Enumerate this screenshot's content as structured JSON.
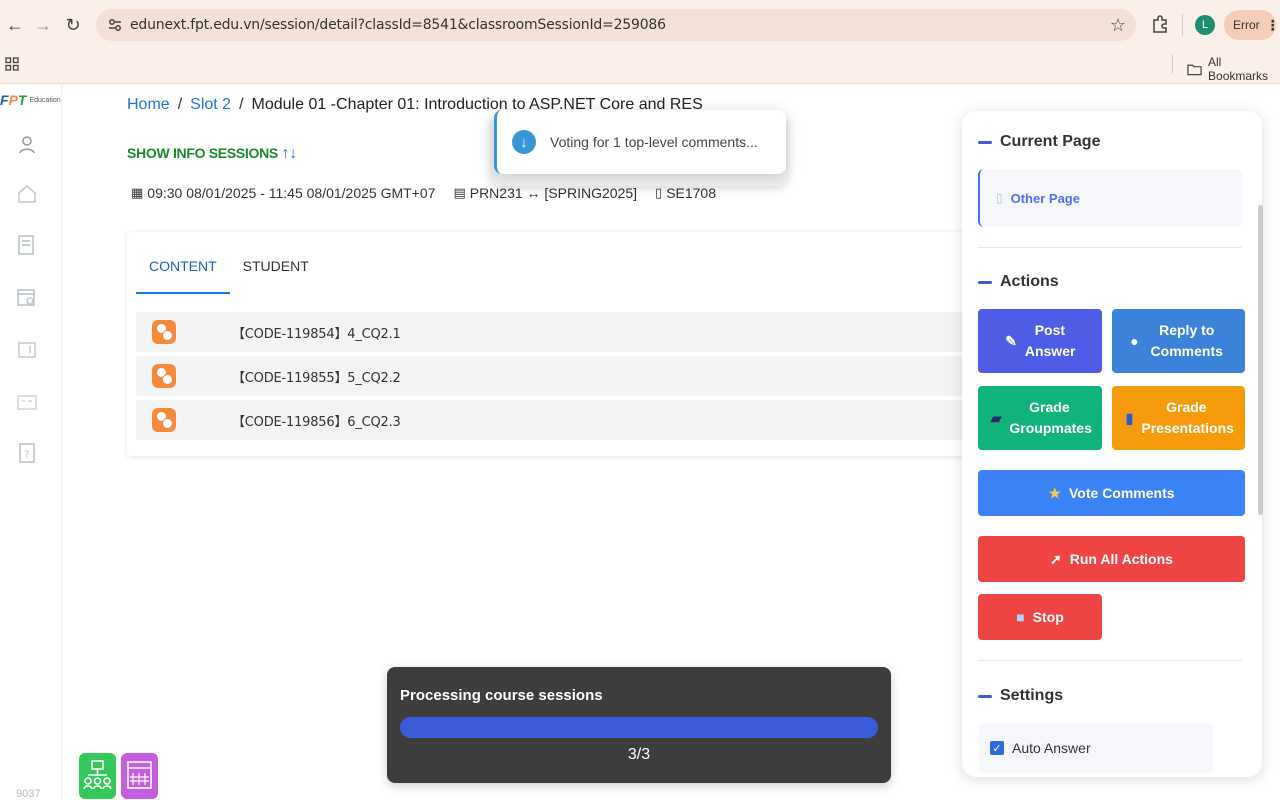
{
  "browser": {
    "url": "edunext.fpt.edu.vn/session/detail?classId=8541&classroomSessionId=259086",
    "profile_initial": "L",
    "error_label": "Error",
    "all_bookmarks": "All Bookmarks"
  },
  "sidebar": {
    "logo_text": "FPT",
    "logo_sub": "Education",
    "version": "9037"
  },
  "breadcrumb": {
    "home": "Home",
    "sep1": "/",
    "slot": "Slot 2",
    "sep2": "/",
    "current": "Module 01 -Chapter 01: Introduction to ASP.NET Core and RES"
  },
  "session": {
    "show_info": "SHOW INFO SESSIONS",
    "time": "09:30 08/01/2025 - 11:45 08/01/2025 GMT+07",
    "course": "PRN231 ↔ [SPRING2025]",
    "class": "SE1708"
  },
  "tabs": [
    {
      "label": "CONTENT",
      "active": true
    },
    {
      "label": "STUDENT",
      "active": false
    }
  ],
  "content_rows": [
    {
      "text": "【CODE-119854】4_CQ2.1"
    },
    {
      "text": "【CODE-119855】5_CQ2.2"
    },
    {
      "text": "【CODE-119856】6_CQ2.3"
    }
  ],
  "toast": {
    "message": "Voting for 1 top-level comments..."
  },
  "panel": {
    "current_page_title": "Current Page",
    "other_page_label": "Other Page",
    "actions_title": "Actions",
    "post_answer": "Post Answer",
    "reply_comments": "Reply to Comments",
    "grade_groupmates": "Grade Groupmates",
    "grade_presentations": "Grade Presentations",
    "vote_comments": "Vote Comments",
    "run_all": "Run All Actions",
    "stop": "Stop",
    "settings_title": "Settings",
    "auto_answer": "Auto Answer"
  },
  "progress": {
    "title": "Processing course sessions",
    "count": "3/3",
    "fraction": 1.0
  },
  "colors": {
    "accent_blue": "#1a73d6",
    "info_green": "#188a2a",
    "row_icon_orange": "#f58a3a",
    "progress_fill": "#3b5bdb"
  }
}
